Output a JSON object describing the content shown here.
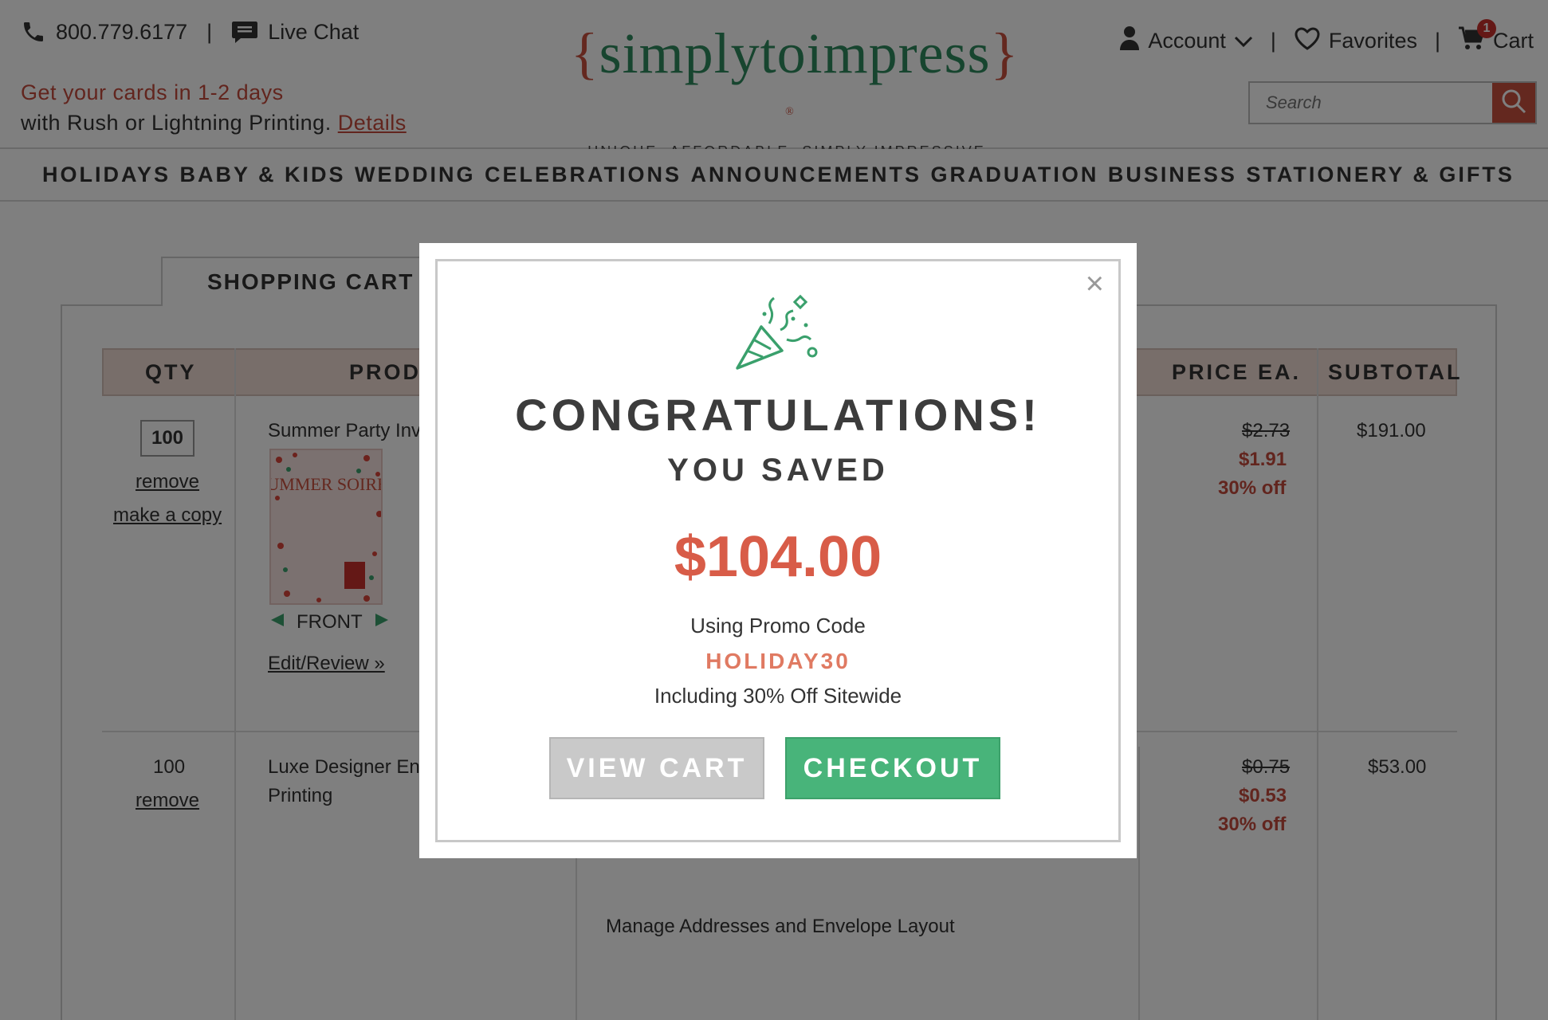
{
  "header": {
    "phone": "800.779.6177",
    "separator": "|",
    "live_chat": "Live Chat",
    "rush_line1": "Get your cards in 1-2 days",
    "rush_line2": "with Rush or Lightning Printing.",
    "details_link": "Details",
    "logo_open_brace": "{",
    "logo_text": "simplytoimpress",
    "logo_close_brace": "}",
    "logo_reg": "®",
    "tagline": "UNIQUE. AFFORDABLE. SIMPLY IMPRESSIVE.",
    "account": "Account",
    "favorites": "Favorites",
    "cart": "Cart",
    "cart_count": "1",
    "search_placeholder": "Search"
  },
  "nav": {
    "items": [
      "HOLIDAYS",
      "BABY & KIDS",
      "WEDDING",
      "CELEBRATIONS",
      "ANNOUNCEMENTS",
      "GRADUATION",
      "BUSINESS",
      "STATIONERY & GIFTS"
    ]
  },
  "cart": {
    "tab_label": "SHOPPING CART",
    "columns": {
      "qty": "QTY",
      "product": "PRODU",
      "price": "PRICE EA.",
      "subtotal": "SUBTOTAL"
    },
    "rows": [
      {
        "qty": "100",
        "remove": "remove",
        "copy": "make a copy",
        "product": "Summer Party Inv",
        "thumb_text": "SUMMER SOIREE",
        "side": "FRONT",
        "edit": "Edit/Review »",
        "orig_price": "$2.73",
        "price": "$1.91",
        "discount": "30% off",
        "subtotal": "$191.00"
      },
      {
        "qty": "100",
        "remove": "remove",
        "product_line1": "Luxe Designer Env",
        "product_line2": "Printing",
        "orig_price": "$0.75",
        "price": "$0.53",
        "discount": "30% off",
        "subtotal": "$53.00"
      }
    ],
    "manage_addresses": "Manage Addresses and Envelope Layout"
  },
  "modal": {
    "close": "×",
    "title": "CONGRATULATIONS!",
    "subtitle": "YOU SAVED",
    "amount": "$104.00",
    "using": "Using Promo Code",
    "code": "HOLIDAY30",
    "including": "Including 30% Off Sitewide",
    "view_cart": "VIEW CART",
    "checkout": "CHECKOUT"
  },
  "colors": {
    "brand_green": "#2f8a5f",
    "brand_red": "#c9503f",
    "promo_red": "#d85c48",
    "checkout_green": "#48b47a",
    "view_cart_gray": "#c9c9c9"
  }
}
